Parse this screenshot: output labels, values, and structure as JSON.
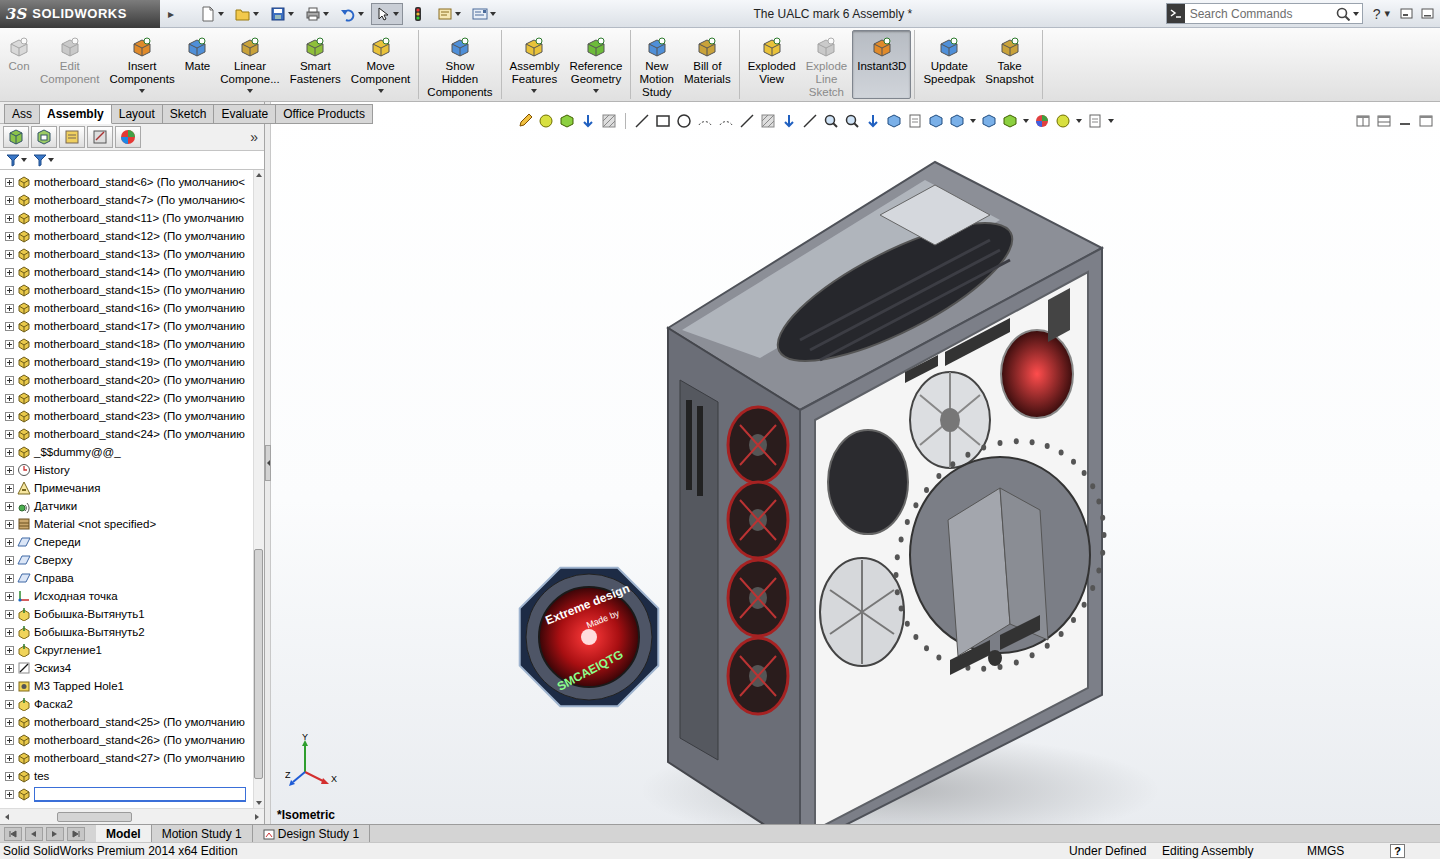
{
  "app": {
    "logo_mark": "3S",
    "logo_text": "SOLIDWORKS",
    "menu_arrow": "▸"
  },
  "window": {
    "title": "The UALC mark 6 Assembly *"
  },
  "search": {
    "placeholder": "Search Commands"
  },
  "title_help": {
    "symbol": "?",
    "arrow": "▾"
  },
  "ribbon": {
    "groups": [
      {
        "buttons": [
          {
            "lines": [
              "Con"
            ],
            "disabled": true,
            "selected": false,
            "dropdown": false
          },
          {
            "lines": [
              "Edit",
              "Component"
            ],
            "disabled": true,
            "selected": false,
            "dropdown": false
          },
          {
            "lines": [
              "Insert",
              "Components"
            ],
            "disabled": false,
            "selected": false,
            "dropdown": true
          },
          {
            "lines": [
              "Mate"
            ],
            "disabled": false,
            "selected": false,
            "dropdown": false
          },
          {
            "lines": [
              "Linear",
              "Compone..."
            ],
            "disabled": false,
            "selected": false,
            "dropdown": true
          },
          {
            "lines": [
              "Smart",
              "Fasteners"
            ],
            "disabled": false,
            "selected": false,
            "dropdown": false
          },
          {
            "lines": [
              "Move",
              "Component"
            ],
            "disabled": false,
            "selected": false,
            "dropdown": true
          }
        ]
      },
      {
        "buttons": [
          {
            "lines": [
              "Show",
              "Hidden",
              "Components"
            ],
            "disabled": false,
            "selected": false,
            "dropdown": false
          }
        ]
      },
      {
        "buttons": [
          {
            "lines": [
              "Assembly",
              "Features"
            ],
            "disabled": false,
            "selected": false,
            "dropdown": true
          },
          {
            "lines": [
              "Reference",
              "Geometry"
            ],
            "disabled": false,
            "selected": false,
            "dropdown": true
          }
        ]
      },
      {
        "buttons": [
          {
            "lines": [
              "New",
              "Motion",
              "Study"
            ],
            "disabled": false,
            "selected": false,
            "dropdown": false
          },
          {
            "lines": [
              "Bill of",
              "Materials"
            ],
            "disabled": false,
            "selected": false,
            "dropdown": false
          }
        ]
      },
      {
        "buttons": [
          {
            "lines": [
              "Exploded",
              "View"
            ],
            "disabled": false,
            "selected": false,
            "dropdown": false
          },
          {
            "lines": [
              "Explode",
              "Line",
              "Sketch"
            ],
            "disabled": true,
            "selected": false,
            "dropdown": false
          },
          {
            "lines": [
              "Instant3D"
            ],
            "disabled": false,
            "selected": true,
            "dropdown": false
          }
        ]
      },
      {
        "buttons": [
          {
            "lines": [
              "Update",
              "Speedpak"
            ],
            "disabled": false,
            "selected": false,
            "dropdown": false
          },
          {
            "lines": [
              "Take",
              "Snapshot"
            ],
            "disabled": false,
            "selected": false,
            "dropdown": false
          }
        ]
      }
    ]
  },
  "command_tabs": [
    {
      "label": "Ass",
      "selected": false
    },
    {
      "label": "Assembly",
      "selected": true
    },
    {
      "label": "Layout",
      "selected": false
    },
    {
      "label": "Sketch",
      "selected": false
    },
    {
      "label": "Evaluate",
      "selected": false
    },
    {
      "label": "Office Products",
      "selected": false
    }
  ],
  "panel": {
    "more": "»",
    "scroll_level": 0.95,
    "hscroll_level": 0.31,
    "tree": [
      {
        "text": "motherboard_stand<6> (По умолчанию<",
        "kind": "component",
        "expanded": false
      },
      {
        "text": "motherboard_stand<7> (По умолчанию<",
        "kind": "component",
        "expanded": false
      },
      {
        "text": "motherboard_stand<11> (По умолчанию",
        "kind": "component",
        "expanded": false
      },
      {
        "text": "motherboard_stand<12> (По умолчанию",
        "kind": "component",
        "expanded": false
      },
      {
        "text": "motherboard_stand<13> (По умолчанию",
        "kind": "component",
        "expanded": false
      },
      {
        "text": "motherboard_stand<14> (По умолчанию",
        "kind": "component",
        "expanded": false
      },
      {
        "text": "motherboard_stand<15> (По умолчанию",
        "kind": "component",
        "expanded": false
      },
      {
        "text": "motherboard_stand<16> (По умолчанию",
        "kind": "component",
        "expanded": false
      },
      {
        "text": "motherboard_stand<17> (По умолчанию",
        "kind": "component",
        "expanded": false
      },
      {
        "text": "motherboard_stand<18> (По умолчанию",
        "kind": "component",
        "expanded": false
      },
      {
        "text": "motherboard_stand<19> (По умолчанию",
        "kind": "component",
        "expanded": false
      },
      {
        "text": "motherboard_stand<20> (По умолчанию",
        "kind": "component",
        "expanded": false
      },
      {
        "text": "motherboard_stand<22> (По умолчанию",
        "kind": "component",
        "expanded": false
      },
      {
        "text": "motherboard_stand<23> (По умолчанию",
        "kind": "component",
        "expanded": false
      },
      {
        "text": "motherboard_stand<24> (По умолчанию",
        "kind": "component",
        "expanded": false
      },
      {
        "text": "_$$dummy@@_",
        "kind": "component",
        "expanded": false
      },
      {
        "text": "History",
        "kind": "history",
        "expanded": false
      },
      {
        "text": "Примечания",
        "kind": "annotations",
        "expanded": false
      },
      {
        "text": "Датчики",
        "kind": "sensors",
        "expanded": false
      },
      {
        "text": "Material <not specified>",
        "kind": "material",
        "expanded": false
      },
      {
        "text": "Спереди",
        "kind": "plane",
        "expanded": false
      },
      {
        "text": "Сверху",
        "kind": "plane",
        "expanded": false
      },
      {
        "text": "Справа",
        "kind": "plane",
        "expanded": false
      },
      {
        "text": "Исходная точка",
        "kind": "origin",
        "expanded": false
      },
      {
        "text": "Бобышка-Вытянуть1",
        "kind": "feature",
        "expanded": false
      },
      {
        "text": "Бобышка-Вытянуть2",
        "kind": "feature",
        "expanded": false
      },
      {
        "text": "Скругление1",
        "kind": "feature",
        "expanded": false
      },
      {
        "text": "Эскиз4",
        "kind": "sketch",
        "expanded": false
      },
      {
        "text": "M3 Tapped Hole1",
        "kind": "hole",
        "expanded": false
      },
      {
        "text": "Фаска2",
        "kind": "feature",
        "expanded": false
      },
      {
        "text": "motherboard_stand<25> (По умолчанию",
        "kind": "component",
        "expanded": false
      },
      {
        "text": "motherboard_stand<26> (По умолчанию",
        "kind": "component",
        "expanded": false
      },
      {
        "text": "motherboard_stand<27> (По умолчанию",
        "kind": "component",
        "expanded": false
      },
      {
        "text": "tes",
        "kind": "component",
        "expanded": false
      },
      {
        "text": "",
        "kind": "editing",
        "expanded": false
      }
    ]
  },
  "viewport": {
    "view_name": "*Isometric",
    "axes": {
      "y": "Y",
      "x": "X",
      "z": "Z"
    },
    "badge": {
      "top": "Extreme design",
      "middle": "Made by",
      "bottom": "SMCAEIQTG"
    }
  },
  "bottom_tabs": [
    {
      "label": "Model",
      "selected": true,
      "kind": "model"
    },
    {
      "label": "Motion Study 1",
      "selected": false,
      "kind": "motion"
    },
    {
      "label": "Design Study 1",
      "selected": false,
      "kind": "design"
    }
  ],
  "status_bar": {
    "product": "Solid SolidWorks Premium 2014 x64 Edition",
    "fields": [
      "Under Defined",
      "Editing Assembly",
      "MMGS"
    ],
    "help": "?"
  }
}
